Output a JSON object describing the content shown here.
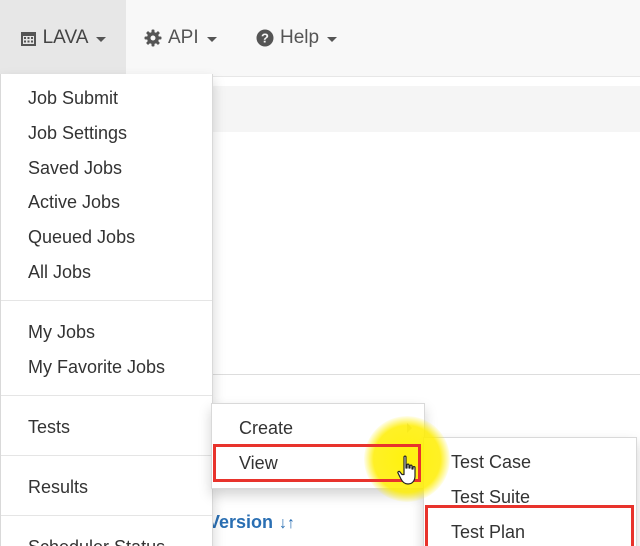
{
  "navbar": {
    "lava": {
      "label": "LAVA",
      "icon": "calendar-icon"
    },
    "api": {
      "label": "API",
      "icon": "gear-icon"
    },
    "help": {
      "label": "Help",
      "icon": "question-circle-icon"
    }
  },
  "lava_menu": {
    "items": [
      "Job Submit",
      "Job Settings",
      "Saved Jobs",
      "Active Jobs",
      "Queued Jobs",
      "All Jobs",
      "My Jobs",
      "My Favorite Jobs",
      "Tests",
      "Results",
      "Scheduler Status"
    ]
  },
  "tests_submenu": {
    "items": [
      "Create",
      "View"
    ]
  },
  "view_submenu": {
    "items": [
      "Test Case",
      "Test Suite",
      "Test Plan"
    ]
  },
  "background": {
    "column_header": "Version",
    "sort_icon": "sort-icon"
  },
  "colors": {
    "highlight": "#e8332c",
    "cursor_spotlight": "#fff200",
    "link": "#2a6fb3"
  }
}
